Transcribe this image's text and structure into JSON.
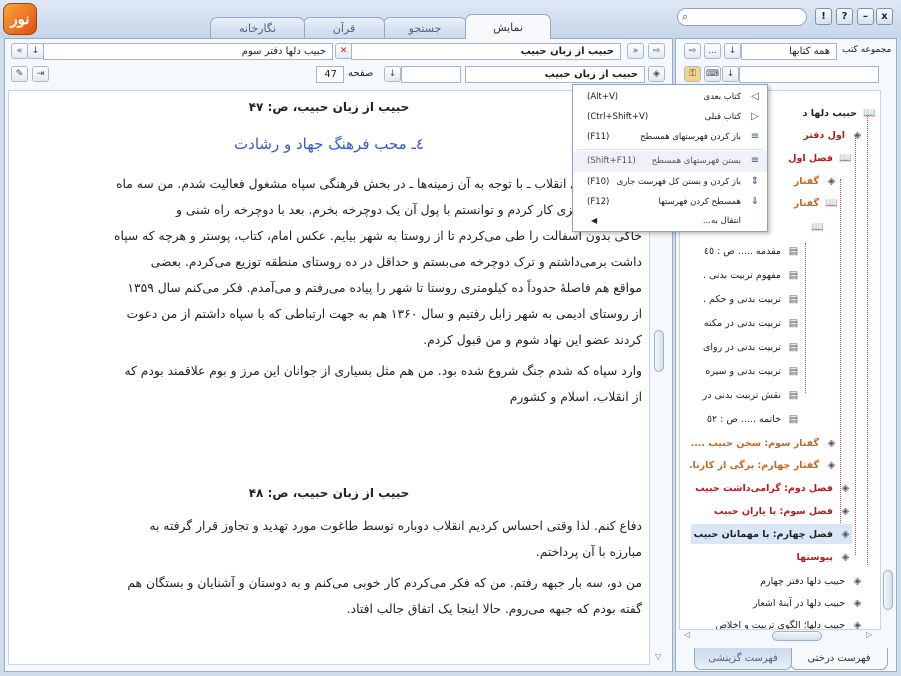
{
  "app": {
    "logo_text": "نور"
  },
  "tabs": [
    {
      "label": "نمایش",
      "active": true
    },
    {
      "label": "جستجو",
      "active": false
    },
    {
      "label": "قرآن",
      "active": false
    },
    {
      "label": "نگارخانه",
      "active": false
    }
  ],
  "window_buttons": {
    "help": "?",
    "info": "!",
    "minimize": "–",
    "close": "x"
  },
  "toolbar": {
    "book_field": "حبیب دلها دفتر سوم",
    "title_field": "حبیب از زبان حبیب",
    "section_field": "حبیب از زبان حبیب",
    "page_label": "صفحه",
    "page_value": "47",
    "nav_back": "«",
    "nav_forward": "»"
  },
  "right_toolbar": {
    "collection_label": "مجموعه کتب",
    "collection_value": "همه کتابها",
    "more": "..."
  },
  "reader": {
    "heading1": "حبیب از زبان حبیب، ص: ۴۷",
    "subheading": "٤ـ محب فرهنگ جهاد و رشادت",
    "paragraphs1": [
      "پس از پیروزی انقلاب ـ با توجه به آن زمینه‌ها ـ در بخش فرهنگی سپاه مشغول فعالیت شدم. من سه ماه",
      "در کورهٔ آجر پزی کار کردم و توانستم با پول آن یک دوچرخه بخرم. بعد با دوچرخه راه شنی و",
      "خاکی بدون آسفالت را طی می‌کردم تا از روستا به شهر بیایم. عکس امام، کتاب، پوستر و هرچه که سپاه",
      "داشت برمی‌داشتم و ترک دوچرخه می‌بستم و حداقل در ده روستای منطقه توزیع می‌کردم. بعضی",
      "مواقع هم فاصلهٔ حدوداً ده کیلومتری روستا تا شهر را پیاده می‌رفتم و می‌آمدم. فکر می‌کنم سال ۱۳۵۹",
      "از روستای ادیمی به شهر زابل رفتیم و سال ۱۳۶۰ هم به جهت ارتباطی که با سپاه داشتم از من دعوت",
      "کردند عضو این نهاد شوم و من قبول کردم.",
      "وارد سپاه که شدم جنگ شروع شده بود. من هم مثل بسیاری از جوانان این مرز و بوم علاقمند بودم که",
      "از انقلاب، اسلام و کشورم"
    ],
    "heading2": "حبیب از زبان حبیب، ص: ۴۸",
    "paragraphs2": [
      "دفاع کنم. لذا وقتی احساس کردیم انقلاب دوباره توسط طاغوت مورد تهدید و تجاوز قرار گرفته به",
      "مبارزه با آن پرداختم.",
      "من دو، سه بار جبهه رفتم. من که فکر می‌کردم کار خوبی می‌کنم و به دوستان و آشنایان و بستگان هم",
      "گفته بودم که جبهه می‌روم. حالا اینجا یک اتفاق جالب افتاد."
    ]
  },
  "context_menu": [
    {
      "label": "کتاب بعدی",
      "shortcut": "(Alt+V)",
      "icon": "◁"
    },
    {
      "label": "کتاب قبلی",
      "shortcut": "(Ctrl+Shift+V)",
      "icon": "▷"
    },
    {
      "label": "باز کردن فهرستهای همسطح",
      "shortcut": "(F11)",
      "icon": "≡"
    },
    {
      "label": "بستن فهرستهای همسطح",
      "shortcut": "(Shift+F11)",
      "icon": "≡"
    },
    {
      "label": "باز کردن و بستن کل فهرست جاری",
      "shortcut": "(F10)",
      "icon": "⇕"
    },
    {
      "label": "همسطح کردن فهرستها",
      "shortcut": "(F12)",
      "icon": "⇓"
    },
    {
      "label": "انتقال به...",
      "shortcut": "",
      "icon": ""
    }
  ],
  "tree": [
    {
      "label": "حبیب دلها د",
      "color": "#222",
      "bold": true
    },
    {
      "label": "اول دفتر",
      "color": "#b21d1d",
      "bold": true
    },
    {
      "label": "فصل اول",
      "color": "#b21d1d",
      "bold": true
    },
    {
      "label": "گفتار",
      "color": "#c8661b",
      "bold": true
    },
    {
      "label": "گفتار",
      "color": "#c8661b",
      "bold": true
    },
    {
      "label": "",
      "color": "#222",
      "bold": false
    },
    {
      "label": "مقدمه ..... ص : ٤٥",
      "color": "#222",
      "bold": false
    },
    {
      "label": "مفهوم تربیت بدنی .",
      "color": "#222",
      "bold": false
    },
    {
      "label": "تربیت بدنی و حکم .",
      "color": "#222",
      "bold": false
    },
    {
      "label": "تربیت بدنی در مکته",
      "color": "#222",
      "bold": false
    },
    {
      "label": "تربیت بدنی در روای",
      "color": "#222",
      "bold": false
    },
    {
      "label": "تربیت بدنی و سیره",
      "color": "#222",
      "bold": false
    },
    {
      "label": "نقش تربیت بدنی در",
      "color": "#222",
      "bold": false
    },
    {
      "label": "خاتمه ..... ص : ٥٢",
      "color": "#222",
      "bold": false
    },
    {
      "label": "گفتار سوم: سخن حبیب ....",
      "color": "#c8661b",
      "bold": true
    },
    {
      "label": "گفتار چهارم: برگی از کارنا.",
      "color": "#c8661b",
      "bold": true
    },
    {
      "label": "فصل دوم: گرامی‌داشت حبیب",
      "color": "#b21d1d",
      "bold": true
    },
    {
      "label": "فصل سوم: با یاران حبیب",
      "color": "#b21d1d",
      "bold": true
    },
    {
      "label": "فصل چهارم: با مهمانان حبیب",
      "color": "#222",
      "bold": true
    },
    {
      "label": "پیوستها",
      "color": "#b21d1d",
      "bold": true
    },
    {
      "label": "حبیب دلها دفتر چهارم",
      "color": "#222",
      "bold": false
    },
    {
      "label": "حبیب دلها در آینهٔ اشعار",
      "color": "#222",
      "bold": false
    },
    {
      "label": "حبیب دلها؛ الگوی تربیت و اخلاص",
      "color": "#222",
      "bold": false
    }
  ],
  "bottom_tabs": [
    {
      "label": "فهرست درختی",
      "active": true
    },
    {
      "label": "فهرست گزینشی",
      "active": false
    }
  ]
}
